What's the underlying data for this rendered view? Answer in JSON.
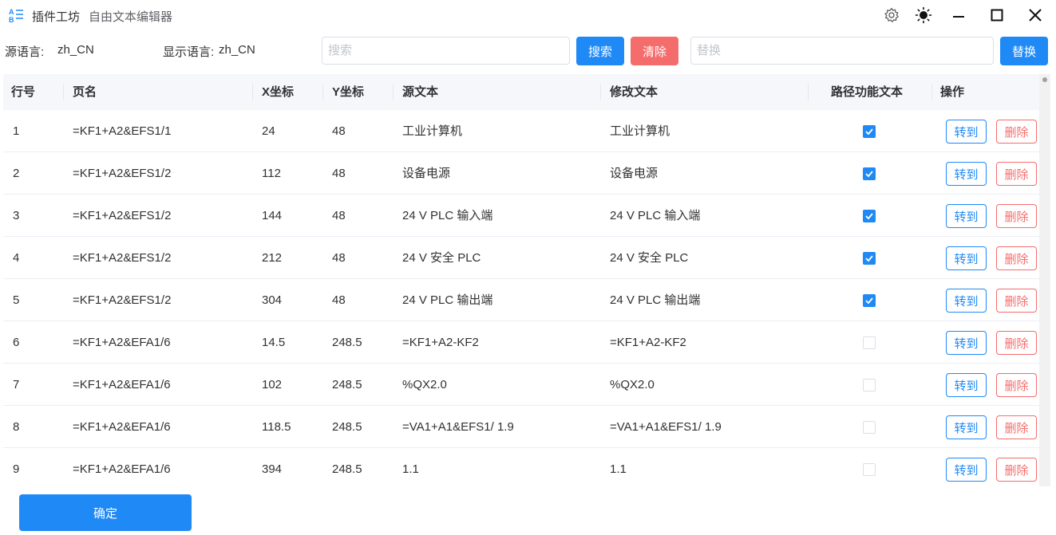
{
  "window": {
    "title": "插件工坊",
    "subtitle": "自由文本编辑器"
  },
  "toolbar": {
    "source_lang_label": "源语言:",
    "source_lang_value": "zh_CN",
    "display_lang_label": "显示语言:",
    "display_lang_value": "zh_CN",
    "search_placeholder": "搜索",
    "search_value": "",
    "search_button": "搜索",
    "clear_button": "清除",
    "replace_placeholder": "替换",
    "replace_value": "",
    "replace_button": "替换"
  },
  "table": {
    "headers": {
      "row_no": "行号",
      "page": "页名",
      "x": "X坐标",
      "y": "Y坐标",
      "source": "源文本",
      "modified": "修改文本",
      "path_func": "路径功能文本",
      "action": "操作"
    },
    "action_goto": "转到",
    "action_delete": "删除",
    "rows": [
      {
        "no": "1",
        "page": "=KF1+A2&EFS1/1",
        "x": "24",
        "y": "48",
        "source": "工业计算机",
        "modified": "工业计算机",
        "path_func": true
      },
      {
        "no": "2",
        "page": "=KF1+A2&EFS1/2",
        "x": "112",
        "y": "48",
        "source": "设备电源",
        "modified": "设备电源",
        "path_func": true
      },
      {
        "no": "3",
        "page": "=KF1+A2&EFS1/2",
        "x": "144",
        "y": "48",
        "source": "24 V PLC 输入端",
        "modified": "24 V PLC 输入端",
        "path_func": true
      },
      {
        "no": "4",
        "page": "=KF1+A2&EFS1/2",
        "x": "212",
        "y": "48",
        "source": "24 V 安全 PLC",
        "modified": "24 V 安全 PLC",
        "path_func": true
      },
      {
        "no": "5",
        "page": "=KF1+A2&EFS1/2",
        "x": "304",
        "y": "48",
        "source": "24 V PLC 输出端",
        "modified": "24 V PLC 输出端",
        "path_func": true
      },
      {
        "no": "6",
        "page": "=KF1+A2&EFA1/6",
        "x": "14.5",
        "y": "248.5",
        "source": "=KF1+A2-KF2",
        "modified": "=KF1+A2-KF2",
        "path_func": false
      },
      {
        "no": "7",
        "page": "=KF1+A2&EFA1/6",
        "x": "102",
        "y": "248.5",
        "source": "%QX2.0",
        "modified": "%QX2.0",
        "path_func": false
      },
      {
        "no": "8",
        "page": "=KF1+A2&EFA1/6",
        "x": "118.5",
        "y": "248.5",
        "source": "=VA1+A1&EFS1/ 1.9",
        "modified": "=VA1+A1&EFS1/ 1.9",
        "path_func": false
      },
      {
        "no": "9",
        "page": "=KF1+A2&EFA1/6",
        "x": "394",
        "y": "248.5",
        "source": "1.1",
        "modified": "1.1",
        "path_func": false
      }
    ]
  },
  "footer": {
    "confirm_button": "确定"
  },
  "icons": {
    "app": "app-logo-icon",
    "settings": "gear-icon",
    "theme": "sun-icon",
    "minimize": "minimize-icon",
    "maximize": "maximize-icon",
    "close": "close-icon",
    "checkbox_checked": "checkmark-icon"
  },
  "colors": {
    "primary": "#1f89f5",
    "danger": "#f56c6c",
    "header_bg": "#f5f7fa",
    "border": "#ebeef5"
  }
}
